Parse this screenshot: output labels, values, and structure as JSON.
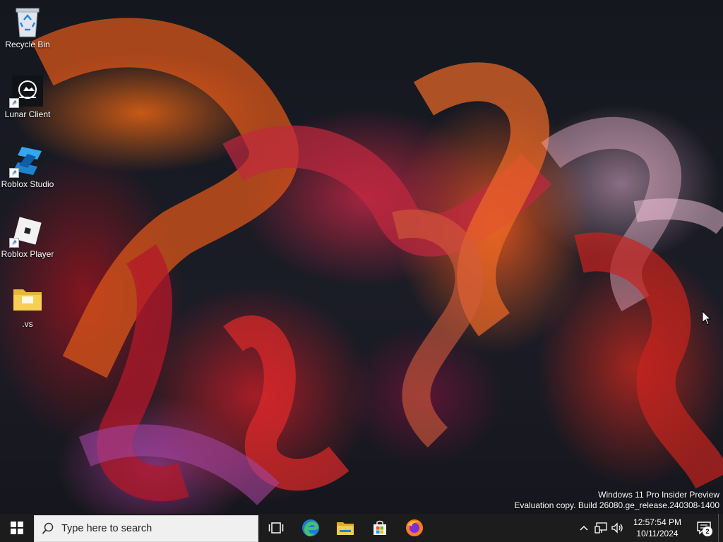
{
  "desktop": {
    "icons": [
      {
        "label": "Recycle Bin",
        "icon": "recycle-bin-icon"
      },
      {
        "label": "Lunar Client",
        "icon": "lunar-client-icon"
      },
      {
        "label": "Roblox Studio",
        "icon": "roblox-studio-icon"
      },
      {
        "label": "Roblox Player",
        "icon": "roblox-player-icon"
      },
      {
        "label": ".vs",
        "icon": "folder-icon"
      }
    ],
    "watermark": {
      "line1": "Windows 11 Pro Insider Preview",
      "line2": "Evaluation copy. Build 26080.ge_release.240308-1400"
    }
  },
  "taskbar": {
    "search_placeholder": "Type here to search",
    "pinned": [
      "task-view-icon",
      "edge-icon",
      "file-explorer-icon",
      "microsoft-store-icon",
      "firefox-icon"
    ],
    "clock": {
      "time": "12:57:54 PM",
      "date": "10/11/2024"
    },
    "notification_count": "2"
  },
  "colors": {
    "taskbar_bg": "#1c1c1c",
    "search_bg": "#f0f0f0",
    "accent": "#0078d7"
  }
}
